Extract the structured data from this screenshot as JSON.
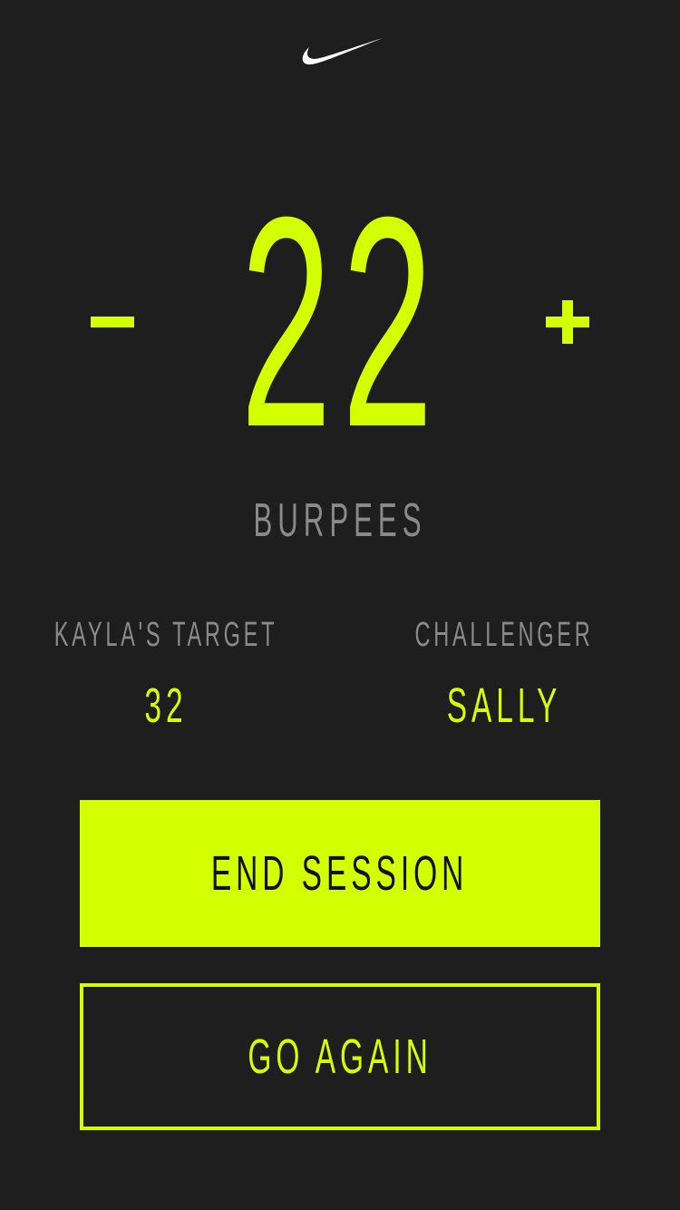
{
  "brand": {
    "logo_icon": "nike-swoosh-icon",
    "logo_color": "#ffffff"
  },
  "counter": {
    "value": "22",
    "decrement_icon": "minus-icon",
    "increment_icon": "plus-icon",
    "exercise": "BURPEES"
  },
  "stats": {
    "target_label": "KAYLA'S TARGET",
    "target_value": "32",
    "challenger_label": "CHALLENGER",
    "challenger_value": "SALLY"
  },
  "actions": {
    "end_session_label": "END SESSION",
    "go_again_label": "GO AGAIN"
  },
  "colors": {
    "background": "#1e1e1e",
    "accent": "#d4ff00",
    "muted": "#8a8a8a"
  }
}
